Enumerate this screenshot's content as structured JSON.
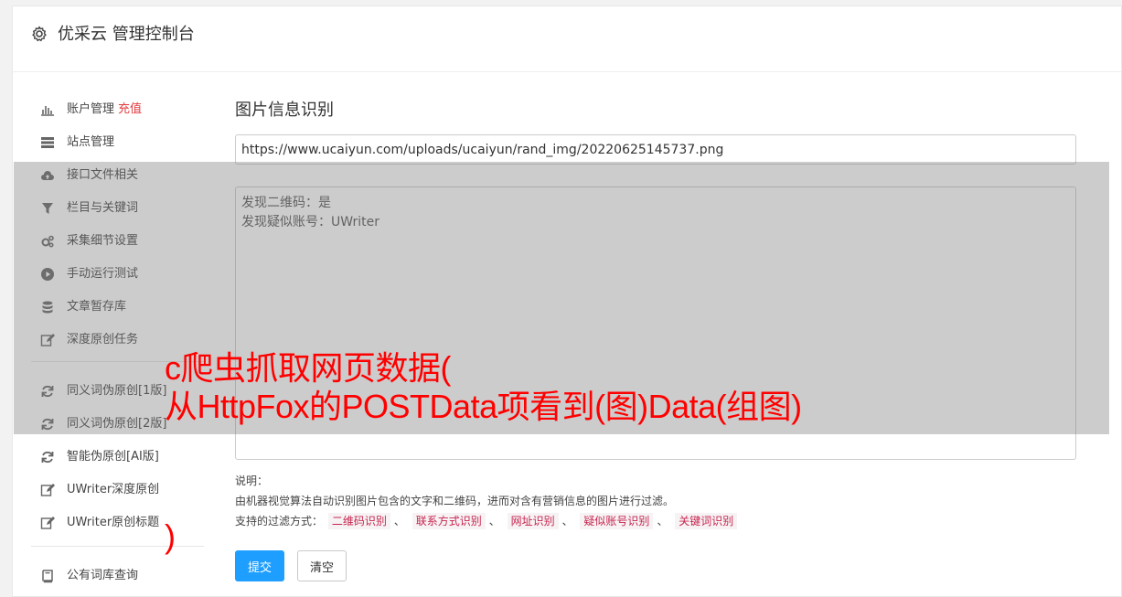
{
  "header": {
    "title": "优采云 管理控制台",
    "icon": "gear-icon"
  },
  "sidebar": {
    "items": [
      {
        "label": "账户管理",
        "badge": "充值",
        "icon": "bar-chart-icon"
      },
      {
        "label": "站点管理",
        "icon": "server-icon"
      },
      {
        "label": "接口文件相关",
        "icon": "cloud-upload-icon"
      },
      {
        "label": "栏目与关键词",
        "icon": "filter-icon"
      },
      {
        "label": "采集细节设置",
        "icon": "cogs-icon"
      },
      {
        "label": "手动运行测试",
        "icon": "play-circle-icon"
      },
      {
        "label": "文章暂存库",
        "icon": "database-icon"
      },
      {
        "label": "深度原创任务",
        "icon": "edit-icon"
      },
      {
        "label": "同义词伪原创[1版]",
        "icon": "refresh-icon"
      },
      {
        "label": "同义词伪原创[2版]",
        "icon": "refresh-icon"
      },
      {
        "label": "智能伪原创[AI版]",
        "icon": "refresh-icon"
      },
      {
        "label": "UWriter深度原创",
        "icon": "edit-icon"
      },
      {
        "label": "UWriter原创标题",
        "icon": "edit-icon"
      },
      {
        "label": "公有词库查询",
        "icon": "book-icon"
      }
    ]
  },
  "main": {
    "title": "图片信息识别",
    "url_value": "https://www.ucaiyun.com/uploads/ucaiyun/rand_img/20220625145737.png",
    "result_lines": [
      "发现二维码：是",
      "发现疑似账号：UWriter"
    ],
    "notes_heading": "说明：",
    "notes_desc": "由机器视觉算法自动识别图片包含的文字和二维码，进而对含有营销信息的图片进行过滤。",
    "filters_label": "支持的过滤方式：",
    "filters": [
      "二维码识别",
      "联系方式识别",
      "网址识别",
      "疑似账号识别",
      "关键词识别"
    ],
    "filter_separator": "、",
    "submit_label": "提交",
    "clear_label": "清空"
  },
  "watermark": {
    "line1": "c爬虫抓取网页数据(",
    "line2": "从HttpFox的POSTData项看到(图)Data(组图)",
    "tail": ")"
  },
  "colors": {
    "accent": "#1e9fff",
    "badge": "#e4393c",
    "tag_text": "#c7254e",
    "watermark": "#ff0000"
  }
}
